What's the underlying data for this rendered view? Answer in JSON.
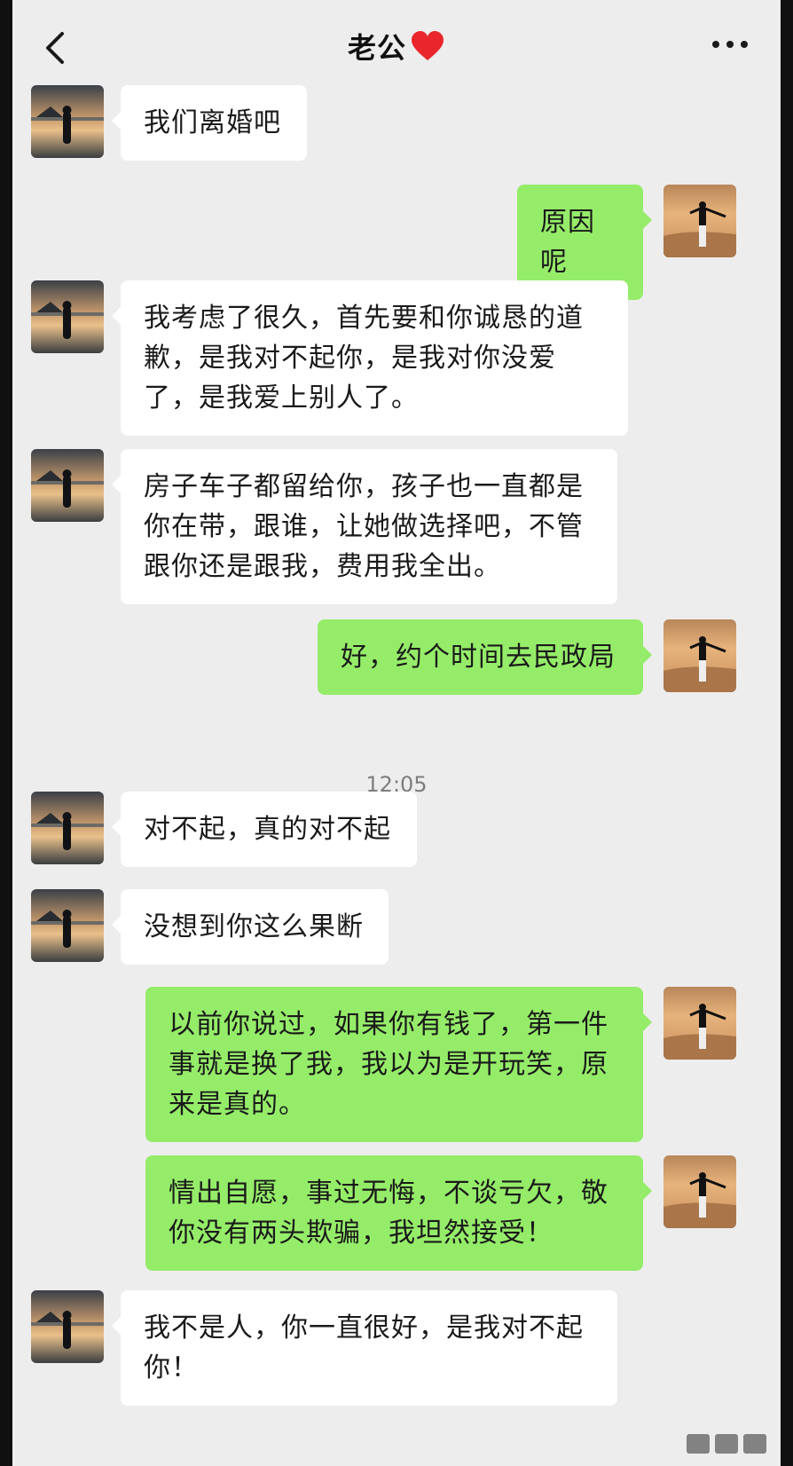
{
  "header": {
    "title": "老公",
    "back_icon": "chevron-left-icon",
    "heart_icon": "red-heart-icon",
    "more_icon": "more-dots-icon"
  },
  "messages": [
    {
      "from": "contact",
      "text": "我们离婚吧"
    },
    {
      "from": "me",
      "text": "原因呢"
    },
    {
      "from": "contact",
      "text": "我考虑了很久，首先要和你诚恳的道歉，是我对不起你，是我对你没爱了，是我爱上别人了。"
    },
    {
      "from": "contact",
      "text": "房子车子都留给你，孩子也一直都是你在带，跟谁，让她做选择吧，不管跟你还是跟我，费用我全出。"
    },
    {
      "from": "me",
      "text": "好，约个时间去民政局"
    },
    {
      "from": "contact",
      "text": "对不起，真的对不起"
    },
    {
      "from": "contact",
      "text": "没想到你这么果断"
    },
    {
      "from": "me",
      "text": "以前你说过，如果你有钱了，第一件事就是换了我，我以为是开玩笑，原来是真的。"
    },
    {
      "from": "me",
      "text": "情出自愿，事过无悔，不谈亏欠，敬你没有两头欺骗，我坦然接受！"
    },
    {
      "from": "contact",
      "text": "我不是人，你一直很好，是我对不起你！"
    }
  ],
  "timestamp": "12:05",
  "colors": {
    "background": "#ededed",
    "incoming_bubble": "#ffffff",
    "outgoing_bubble": "#95ec69",
    "heart": "#e8262b"
  }
}
